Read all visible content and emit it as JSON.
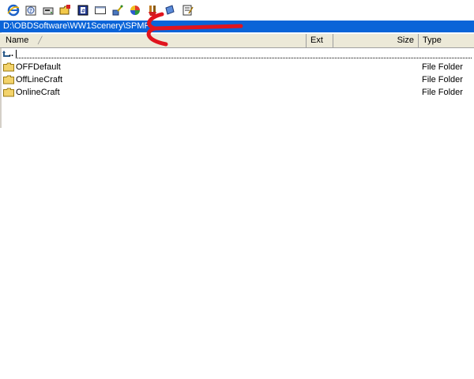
{
  "toolbar": {
    "buttons": [
      {
        "name": "internet-explorer-icon"
      },
      {
        "name": "help-icon"
      },
      {
        "name": "drive-icon"
      },
      {
        "name": "new-folder-icon"
      },
      {
        "name": "properties-icon"
      },
      {
        "name": "window-icon"
      },
      {
        "name": "tools-icon"
      },
      {
        "name": "color-wheel-icon"
      },
      {
        "name": "brush-icon"
      },
      {
        "name": "note-icon"
      },
      {
        "name": "notepad-icon"
      }
    ]
  },
  "path": "D:\\OBDSoftware\\WW1Scenery\\SPMP",
  "columns": {
    "name": "Name",
    "ext": "Ext",
    "size": "Size",
    "type": "Type"
  },
  "up_dir_label": "..",
  "files": [
    {
      "name": "OFFDefault",
      "type": "File Folder"
    },
    {
      "name": "OffLineCraft",
      "type": "File Folder"
    },
    {
      "name": "OnlineCraft",
      "type": "File Folder"
    }
  ],
  "colors": {
    "path_bar": "#0a64d8",
    "annotation": "#e0141e",
    "folder": "#f3d36b"
  }
}
